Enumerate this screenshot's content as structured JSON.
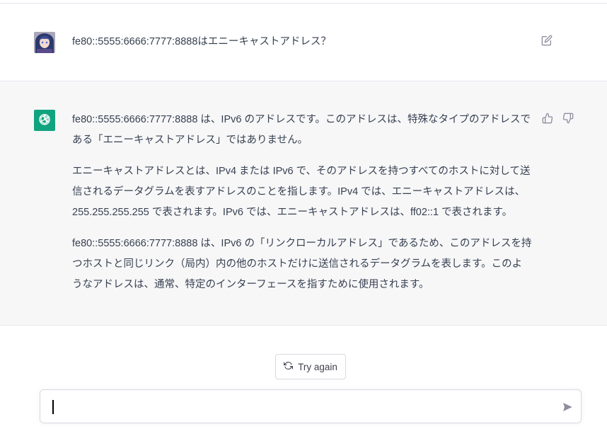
{
  "user_message": {
    "text": "fe80::5555:6666:7777:8888はエニーキャストアドレス？",
    "edit_icon": "edit-icon"
  },
  "assistant_message": {
    "paragraphs": [
      "fe80::5555:6666:7777:8888 は、IPv6 のアドレスです。このアドレスは、特殊なタイプのアドレスである「エニーキャストアドレス」ではありません。",
      "エニーキャストアドレスとは、IPv4 または IPv6 で、そのアドレスを持つすべてのホストに対して送信されるデータグラムを表すアドレスのことを指します。IPv4 では、エニーキャストアドレスは、255.255.255.255 で表されます。IPv6 では、エニーキャストアドレスは、ff02::1 で表されます。",
      "fe80::5555:6666:7777:8888 は、IPv6 の「リンクローカルアドレス」であるため、このアドレスを持つホストと同じリンク（局内）内の他のホストだけに送信されるデータグラムを表します。このようなアドレスは、通常、特定のインターフェースを指すために使用されます。"
    ],
    "icons": [
      "thumbs-up-icon",
      "thumbs-down-icon"
    ]
  },
  "actions": {
    "try_again_label": "Try again"
  },
  "composer": {
    "value": "",
    "placeholder": ""
  },
  "colors": {
    "assistant_bg": "#f7f7f8",
    "logo_green": "#10a37f",
    "text": "#374151",
    "border": "#e5e7eb"
  }
}
